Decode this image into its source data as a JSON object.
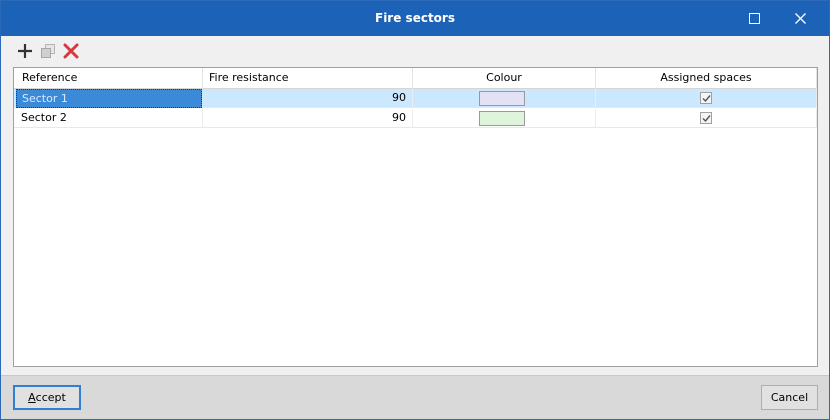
{
  "window": {
    "title": "Fire sectors"
  },
  "toolbar": {
    "icons": [
      "add-icon",
      "copy-icon",
      "delete-icon"
    ]
  },
  "table": {
    "columns": [
      "Reference",
      "Fire resistance",
      "Colour",
      "Assigned spaces"
    ],
    "rows": [
      {
        "reference": "Sector 1",
        "fire_resistance": "90",
        "colour": "#e3e1f5",
        "assigned": true,
        "selected": true
      },
      {
        "reference": "Sector 2",
        "fire_resistance": "90",
        "colour": "#dff5db",
        "assigned": true,
        "selected": false
      }
    ]
  },
  "footer": {
    "accept_mnemonic": "A",
    "accept_rest": "ccept",
    "cancel_label": "Cancel"
  },
  "colors": {
    "titlebar": "#1c63b7",
    "selection": "#cce8ff",
    "delete": "#d9363e"
  }
}
